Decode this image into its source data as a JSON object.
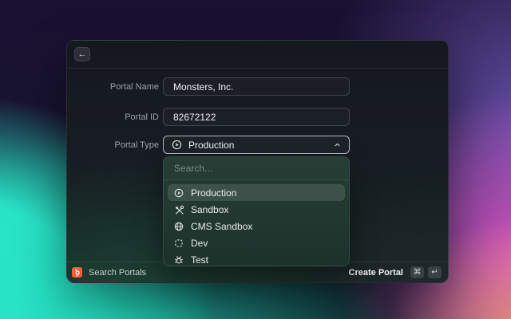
{
  "modal": {
    "back_icon": "←",
    "fields": [
      {
        "label": "Portal Name",
        "value": "Monsters, Inc."
      },
      {
        "label": "Portal ID",
        "value": "82672122"
      },
      {
        "label": "Portal Type",
        "value": "Production",
        "icon": "play-circle-icon",
        "state": "open"
      }
    ]
  },
  "dropdown": {
    "search_placeholder": "Search...",
    "options": [
      {
        "label": "Production",
        "icon": "play-circle-icon",
        "selected": true
      },
      {
        "label": "Sandbox",
        "icon": "tools-icon",
        "selected": false
      },
      {
        "label": "CMS Sandbox",
        "icon": "globe-icon",
        "selected": false
      },
      {
        "label": "Dev",
        "icon": "dashed-box-icon",
        "selected": false
      },
      {
        "label": "Test",
        "icon": "bug-icon",
        "selected": false
      }
    ]
  },
  "footer": {
    "left_label": "Search Portals",
    "left_icon": "hubspot-logo-icon",
    "right_label": "Create Portal",
    "shortcut_keys": [
      "⌘",
      "↵"
    ]
  },
  "colors": {
    "brand_orange": "#FF5C35",
    "background_navy": "#1A1132",
    "background_teal": "#2FF2D2",
    "background_purple": "#6D55B4",
    "background_pink": "#E355C8",
    "background_salmon": "#F2967C",
    "panel_green": "#273F36",
    "selected_row": "rgba(255,255,255,0.12)"
  }
}
